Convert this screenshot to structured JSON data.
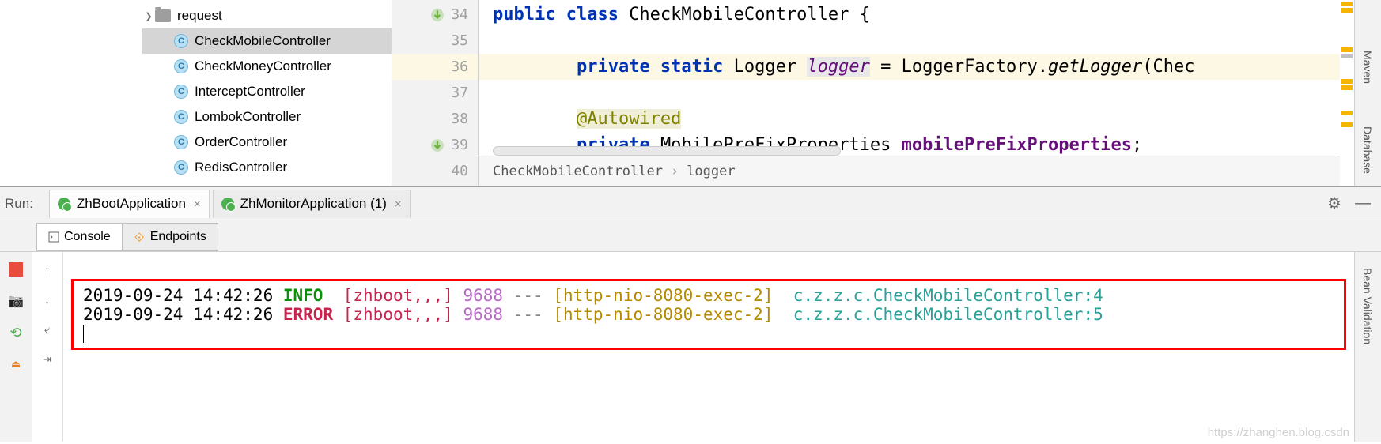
{
  "tree": {
    "folder": "request",
    "files": [
      "CheckMobileController",
      "CheckMoneyController",
      "InterceptController",
      "LombokController",
      "OrderController",
      "RedisController"
    ],
    "selectedIndex": 0
  },
  "gutter": {
    "lines": [
      "34",
      "35",
      "36",
      "37",
      "38",
      "39",
      "40"
    ]
  },
  "code": {
    "line34": {
      "kw1": "public class ",
      "type": "CheckMobileController",
      "brace": " {"
    },
    "line36": {
      "indent": "        ",
      "kw": "private static ",
      "type": "Logger ",
      "field": "logger",
      "eq": " = LoggerFactory.",
      "method": "getLogger",
      "rest": "(Chec"
    },
    "line38": {
      "indent": "        ",
      "anno": "@Autowired"
    },
    "line39": {
      "indent": "        ",
      "kw": "private ",
      "type": "MobilePreFixProperties ",
      "field": "mobilePreFixProperties",
      "semi": ";"
    }
  },
  "breadcrumb": {
    "item1": "CheckMobileController",
    "item2": "logger"
  },
  "rightSidebar": {
    "label1": "Maven",
    "label2": "Database",
    "label3": "Bean Validation"
  },
  "run": {
    "label": "Run:",
    "tabs": [
      {
        "label": "ZhBootApplication",
        "closable": true
      },
      {
        "label": "ZhMonitorApplication (1)",
        "closable": true
      }
    ]
  },
  "consoleTabs": {
    "tab1": "Console",
    "tab2": "Endpoints"
  },
  "logs": {
    "line1": {
      "time": "2019-09-24 14:42:26",
      "level": "INFO ",
      "app": "[zhboot,,,]",
      "pid": "9688",
      "dash": "---",
      "thread": "[http-nio-8080-exec-2]",
      "class": "c.z.z.c.CheckMobileController",
      "tail": ":4"
    },
    "line2": {
      "time": "2019-09-24 14:42:26",
      "level": "ERROR",
      "app": "[zhboot,,,]",
      "pid": "9688",
      "dash": "---",
      "thread": "[http-nio-8080-exec-2]",
      "class": "c.z.z.c.CheckMobileController",
      "tail": ":5"
    }
  },
  "watermark": "https://zhanghen.blog.csdn"
}
